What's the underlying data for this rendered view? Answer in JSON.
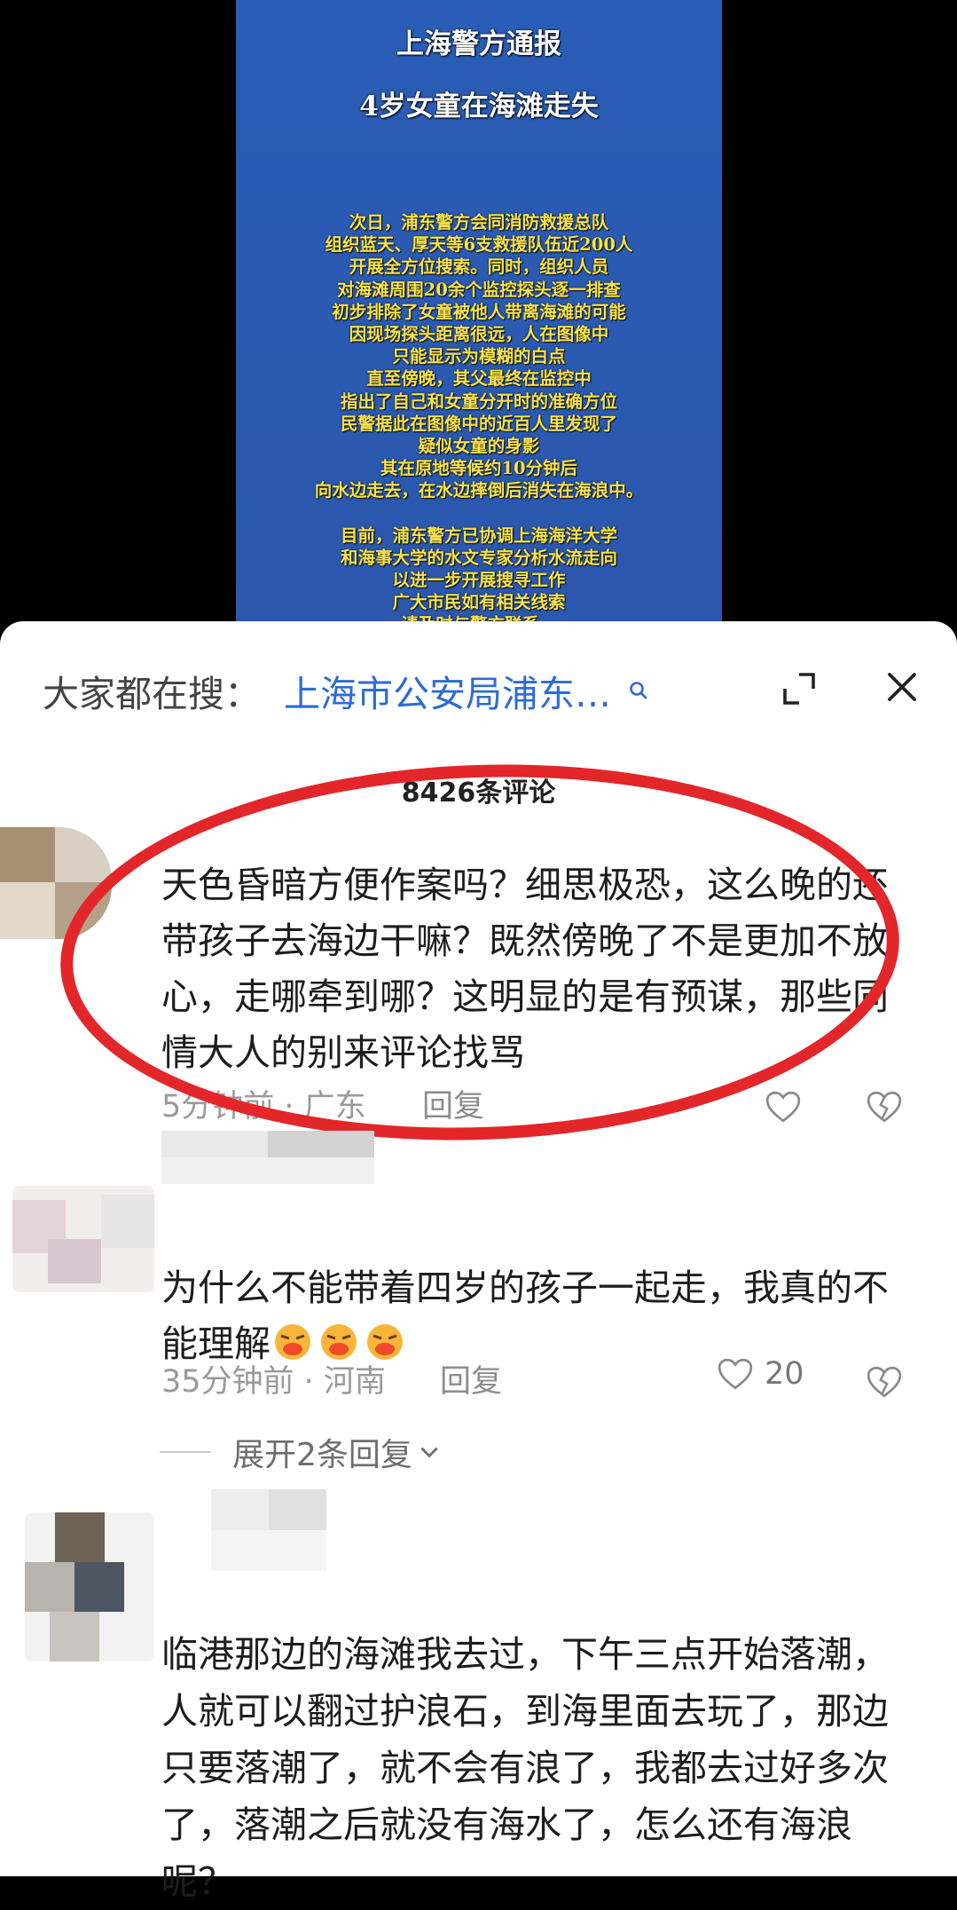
{
  "video": {
    "title_line1": "上海警方通报",
    "title_line2": "4岁女童在海滩走失",
    "paragraph1": "次日，浦东警方会同消防救援总队\n组织蓝天、厚天等6支救援队伍近200人\n开展全方位搜索。同时，组织人员\n对海滩周围20余个监控探头逐一排查\n初步排除了女童被他人带离海滩的可能\n因现场探头距离很远，人在图像中\n只能显示为模糊的白点\n直至傍晚，其父最终在监控中\n指出了自己和女童分开时的准确方位\n民警据此在图像中的近百人里发现了\n疑似女童的身影\n其在原地等候约10分钟后\n向水边走去，在水边摔倒后消失在海浪中。",
    "paragraph2": "目前，浦东警方已协调上海海洋大学\n和海事大学的水文专家分析水流走向\n以进一步开展搜寻工作\n广大市民如有相关线索\n请及时与警方联系。"
  },
  "search": {
    "prefix": "大家都在搜：",
    "query": "上海市公安局浦东…"
  },
  "comments_header": {
    "count": "8426条评论"
  },
  "comments": [
    {
      "text": "天色昏暗方便作案吗？细思极恐，这么晚的还带孩子去海边干嘛？既然傍晚了不是更加不放心，走哪牵到哪？这明显的是有预谋，那些同情大人的别来评论找骂",
      "meta": "5分钟前 · 广东",
      "reply": "回复",
      "likes": ""
    },
    {
      "text": "为什么不能带着四岁的孩子一起走，我真的不能理解",
      "meta": "35分钟前 · 河南",
      "reply": "回复",
      "likes": "20",
      "expand_replies": "展开2条回复"
    },
    {
      "text": "临港那边的海滩我去过，下午三点开始落潮，人就可以翻过护浪石，到海里面去玩了，那边只要落潮了，就不会有浪了，我都去过好多次了，落潮之后就没有海水了，怎么还有海浪呢？"
    }
  ],
  "colors": {
    "notice_bg": "#2a5db7",
    "notice_text": "#f6e24a",
    "link": "#2d6bd6",
    "highlight": "#e3262a"
  }
}
